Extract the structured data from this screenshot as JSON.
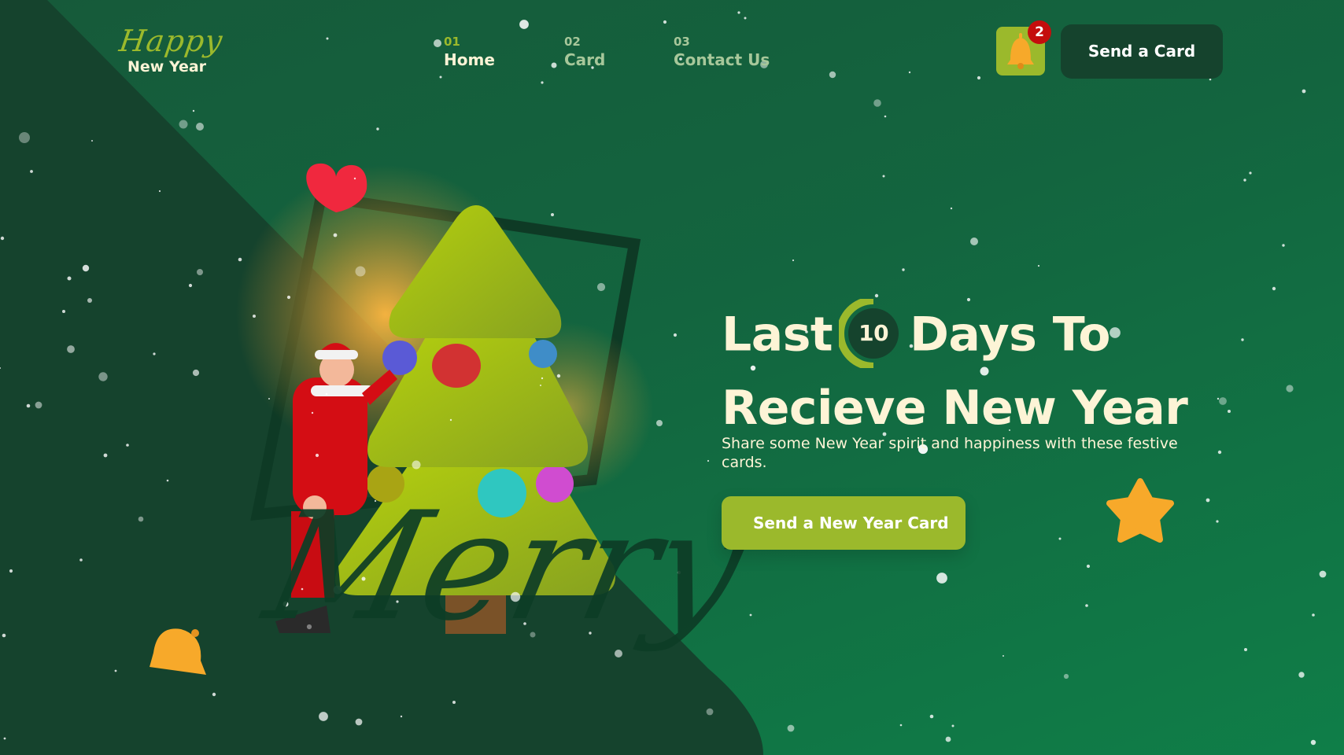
{
  "logo": {
    "script": "Happy",
    "text": "New Year"
  },
  "nav": [
    {
      "number": "01",
      "label": "Home",
      "active": true
    },
    {
      "number": "02",
      "label": "Card",
      "active": false
    },
    {
      "number": "03",
      "label": "Contact Us",
      "active": false
    }
  ],
  "notifications": {
    "icon": "bell-icon",
    "count": "2"
  },
  "header": {
    "send_card_label": "Send a Card"
  },
  "hero": {
    "headline_before": "Last",
    "days": "10",
    "headline_after": "Days To",
    "headline_line2": "Recieve New Year",
    "subtitle": "Share some New Year spirit and happiness with these festive cards.",
    "cta_label": "Send a New Year Card"
  },
  "illustration": {
    "script_text": "Merry"
  },
  "colors": {
    "accent": "#9bb92c",
    "dark": "#15432d",
    "text": "#fdf4d6",
    "badge": "#c40d0d"
  }
}
